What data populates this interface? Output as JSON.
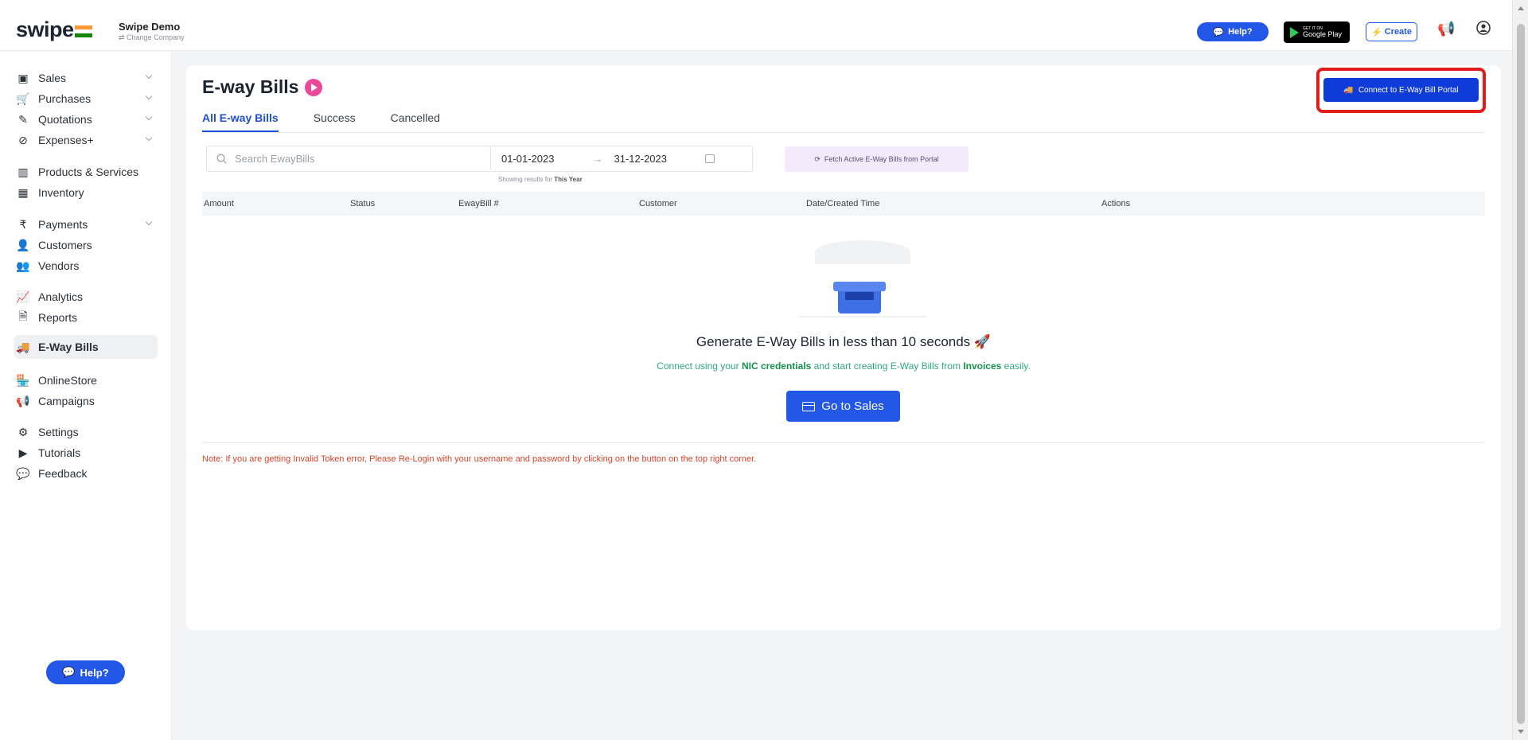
{
  "header": {
    "logo": "swipe",
    "company_name": "Swipe Demo",
    "company_change": "⇄ Change Company",
    "help_label": "Help?",
    "gplay_small": "GET IT ON",
    "gplay_big": "Google Play",
    "create_label": "Create",
    "flag_colors": [
      "#ff9933",
      "#ffffff",
      "#138808"
    ]
  },
  "sidebar": {
    "items": [
      {
        "label": "Sales",
        "icon": "sales-icon",
        "chevron": true
      },
      {
        "label": "Purchases",
        "icon": "cart-icon",
        "chevron": true
      },
      {
        "label": "Quotations",
        "icon": "pen-icon",
        "chevron": true
      },
      {
        "label": "Expenses+",
        "icon": "tag-icon",
        "chevron": true
      },
      {
        "label": "Products & Services",
        "icon": "barcode-icon",
        "chevron": false
      },
      {
        "label": "Inventory",
        "icon": "inventory-icon",
        "chevron": false
      },
      {
        "label": "Payments",
        "icon": "rupee-icon",
        "chevron": true
      },
      {
        "label": "Customers",
        "icon": "user-icon",
        "chevron": false
      },
      {
        "label": "Vendors",
        "icon": "users-icon",
        "chevron": false
      },
      {
        "label": "Analytics",
        "icon": "chart-icon",
        "chevron": false
      },
      {
        "label": "Reports",
        "icon": "report-icon",
        "chevron": false
      },
      {
        "label": "E-Way Bills",
        "icon": "truck-icon",
        "chevron": false,
        "active": true
      },
      {
        "label": "OnlineStore",
        "icon": "store-icon",
        "chevron": false
      },
      {
        "label": "Campaigns",
        "icon": "megaphone-icon",
        "chevron": false
      },
      {
        "label": "Settings",
        "icon": "settings-icon",
        "chevron": false
      },
      {
        "label": "Tutorials",
        "icon": "youtube-icon",
        "chevron": false
      },
      {
        "label": "Feedback",
        "icon": "feedback-icon",
        "chevron": false
      }
    ],
    "help_label": "Help?"
  },
  "main": {
    "title": "E-way Bills",
    "connect_label": "Connect to E-Way Bill Portal",
    "tabs": [
      "All E-way Bills",
      "Success",
      "Cancelled"
    ],
    "search_placeholder": "Search EwayBills",
    "date_from": "01-01-2023",
    "date_to": "31-12-2023",
    "showing_prefix": "Showing results for",
    "showing_period": "This Year",
    "fetch_label": "Fetch Active E-Way Bills from Portal",
    "columns": [
      "Amount",
      "Status",
      "EwayBill #",
      "Customer",
      "Date/Created Time",
      "Actions"
    ],
    "empty_title": "Generate E-Way Bills in less than 10 seconds 🚀",
    "empty_sub_1": "Connect using your",
    "empty_sub_nic": "NIC credentials",
    "empty_sub_2": "and start creating E-Way Bills from",
    "empty_sub_invoices": "Invoices",
    "empty_sub_3": "easily.",
    "go_sales_label": "Go to Sales",
    "note": "Note: If you are getting Invalid Token error, Please Re-Login with your username and password by clicking on the button on the top right corner."
  },
  "colors": {
    "accent": "#2257e7",
    "connect_button": "#0f3bd8",
    "highlight_border": "#e31b1b",
    "note_text": "#d9442a",
    "success_text": "#16924d"
  }
}
